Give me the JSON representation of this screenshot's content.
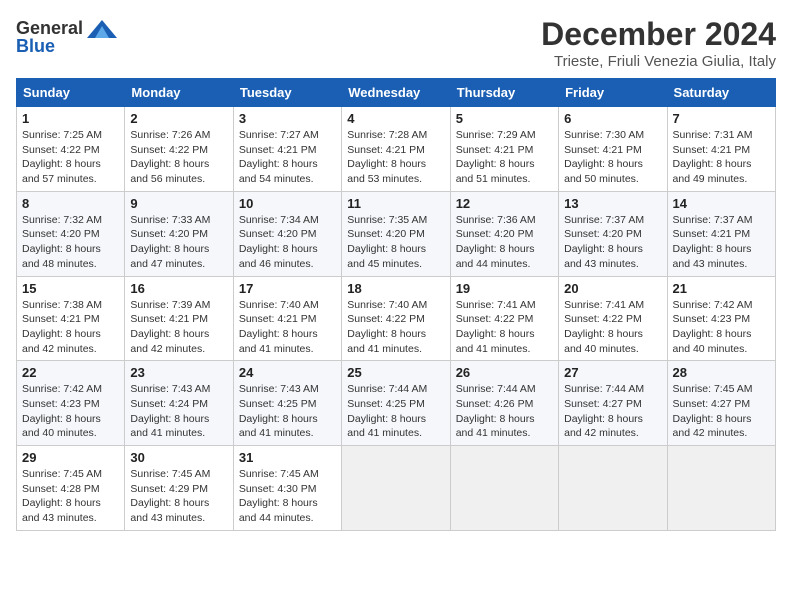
{
  "logo": {
    "general": "General",
    "blue": "Blue"
  },
  "title": "December 2024",
  "location": "Trieste, Friuli Venezia Giulia, Italy",
  "days_of_week": [
    "Sunday",
    "Monday",
    "Tuesday",
    "Wednesday",
    "Thursday",
    "Friday",
    "Saturday"
  ],
  "weeks": [
    [
      {
        "day": "1",
        "sunrise": "7:25 AM",
        "sunset": "4:22 PM",
        "daylight": "8 hours and 57 minutes."
      },
      {
        "day": "2",
        "sunrise": "7:26 AM",
        "sunset": "4:22 PM",
        "daylight": "8 hours and 56 minutes."
      },
      {
        "day": "3",
        "sunrise": "7:27 AM",
        "sunset": "4:21 PM",
        "daylight": "8 hours and 54 minutes."
      },
      {
        "day": "4",
        "sunrise": "7:28 AM",
        "sunset": "4:21 PM",
        "daylight": "8 hours and 53 minutes."
      },
      {
        "day": "5",
        "sunrise": "7:29 AM",
        "sunset": "4:21 PM",
        "daylight": "8 hours and 51 minutes."
      },
      {
        "day": "6",
        "sunrise": "7:30 AM",
        "sunset": "4:21 PM",
        "daylight": "8 hours and 50 minutes."
      },
      {
        "day": "7",
        "sunrise": "7:31 AM",
        "sunset": "4:21 PM",
        "daylight": "8 hours and 49 minutes."
      }
    ],
    [
      {
        "day": "8",
        "sunrise": "7:32 AM",
        "sunset": "4:20 PM",
        "daylight": "8 hours and 48 minutes."
      },
      {
        "day": "9",
        "sunrise": "7:33 AM",
        "sunset": "4:20 PM",
        "daylight": "8 hours and 47 minutes."
      },
      {
        "day": "10",
        "sunrise": "7:34 AM",
        "sunset": "4:20 PM",
        "daylight": "8 hours and 46 minutes."
      },
      {
        "day": "11",
        "sunrise": "7:35 AM",
        "sunset": "4:20 PM",
        "daylight": "8 hours and 45 minutes."
      },
      {
        "day": "12",
        "sunrise": "7:36 AM",
        "sunset": "4:20 PM",
        "daylight": "8 hours and 44 minutes."
      },
      {
        "day": "13",
        "sunrise": "7:37 AM",
        "sunset": "4:20 PM",
        "daylight": "8 hours and 43 minutes."
      },
      {
        "day": "14",
        "sunrise": "7:37 AM",
        "sunset": "4:21 PM",
        "daylight": "8 hours and 43 minutes."
      }
    ],
    [
      {
        "day": "15",
        "sunrise": "7:38 AM",
        "sunset": "4:21 PM",
        "daylight": "8 hours and 42 minutes."
      },
      {
        "day": "16",
        "sunrise": "7:39 AM",
        "sunset": "4:21 PM",
        "daylight": "8 hours and 42 minutes."
      },
      {
        "day": "17",
        "sunrise": "7:40 AM",
        "sunset": "4:21 PM",
        "daylight": "8 hours and 41 minutes."
      },
      {
        "day": "18",
        "sunrise": "7:40 AM",
        "sunset": "4:22 PM",
        "daylight": "8 hours and 41 minutes."
      },
      {
        "day": "19",
        "sunrise": "7:41 AM",
        "sunset": "4:22 PM",
        "daylight": "8 hours and 41 minutes."
      },
      {
        "day": "20",
        "sunrise": "7:41 AM",
        "sunset": "4:22 PM",
        "daylight": "8 hours and 40 minutes."
      },
      {
        "day": "21",
        "sunrise": "7:42 AM",
        "sunset": "4:23 PM",
        "daylight": "8 hours and 40 minutes."
      }
    ],
    [
      {
        "day": "22",
        "sunrise": "7:42 AM",
        "sunset": "4:23 PM",
        "daylight": "8 hours and 40 minutes."
      },
      {
        "day": "23",
        "sunrise": "7:43 AM",
        "sunset": "4:24 PM",
        "daylight": "8 hours and 41 minutes."
      },
      {
        "day": "24",
        "sunrise": "7:43 AM",
        "sunset": "4:25 PM",
        "daylight": "8 hours and 41 minutes."
      },
      {
        "day": "25",
        "sunrise": "7:44 AM",
        "sunset": "4:25 PM",
        "daylight": "8 hours and 41 minutes."
      },
      {
        "day": "26",
        "sunrise": "7:44 AM",
        "sunset": "4:26 PM",
        "daylight": "8 hours and 41 minutes."
      },
      {
        "day": "27",
        "sunrise": "7:44 AM",
        "sunset": "4:27 PM",
        "daylight": "8 hours and 42 minutes."
      },
      {
        "day": "28",
        "sunrise": "7:45 AM",
        "sunset": "4:27 PM",
        "daylight": "8 hours and 42 minutes."
      }
    ],
    [
      {
        "day": "29",
        "sunrise": "7:45 AM",
        "sunset": "4:28 PM",
        "daylight": "8 hours and 43 minutes."
      },
      {
        "day": "30",
        "sunrise": "7:45 AM",
        "sunset": "4:29 PM",
        "daylight": "8 hours and 43 minutes."
      },
      {
        "day": "31",
        "sunrise": "7:45 AM",
        "sunset": "4:30 PM",
        "daylight": "8 hours and 44 minutes."
      },
      null,
      null,
      null,
      null
    ]
  ]
}
